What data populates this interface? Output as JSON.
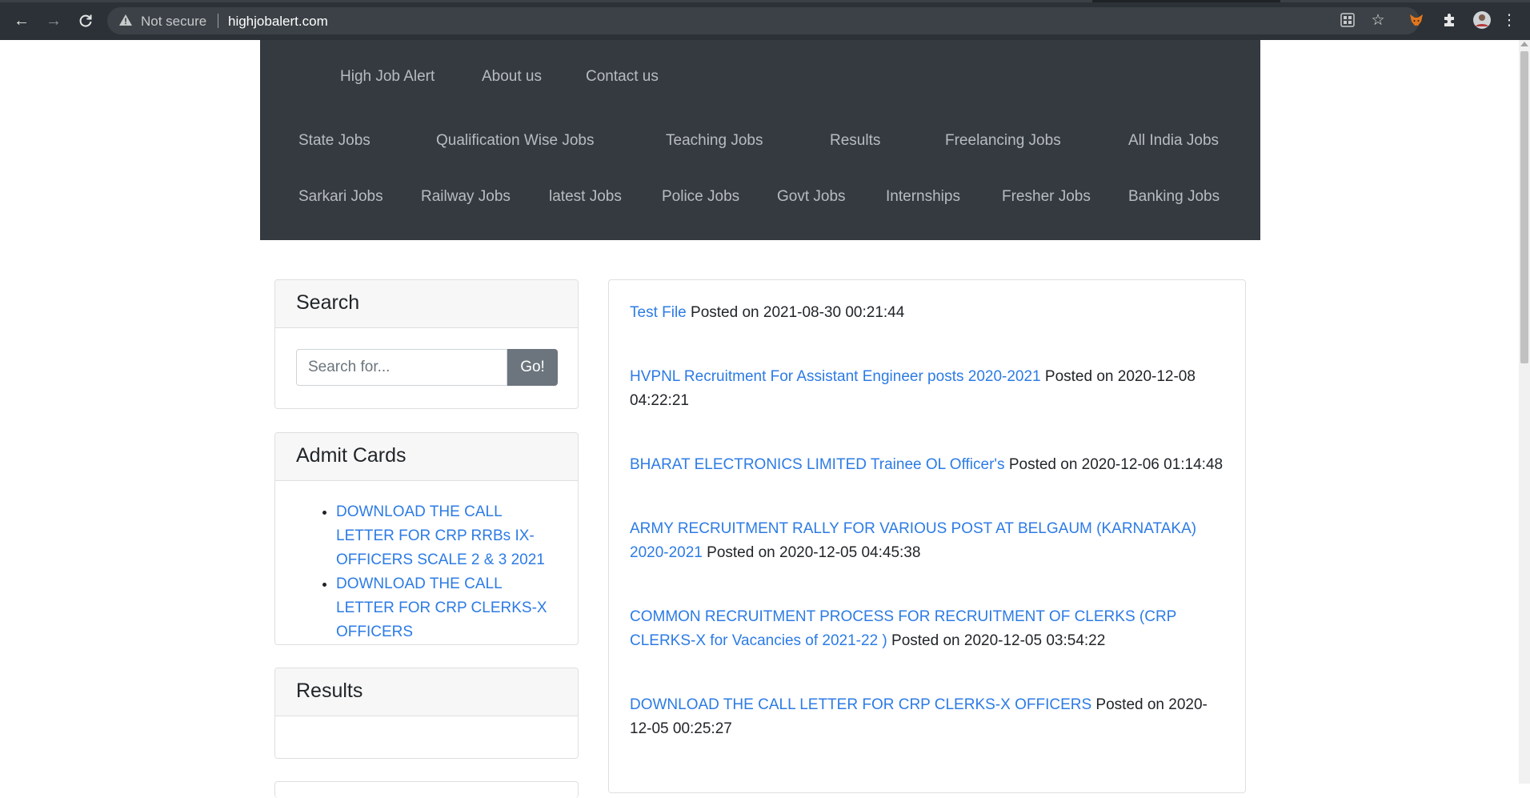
{
  "browser": {
    "security_label": "Not secure",
    "url": "highjobalert.com"
  },
  "nav": {
    "top": [
      "High Job Alert",
      "About us",
      "Contact us"
    ],
    "row1": [
      "State Jobs",
      "Qualification Wise Jobs",
      "Teaching Jobs",
      "Results",
      "Freelancing Jobs",
      "All India Jobs"
    ],
    "row2": [
      "Sarkari Jobs",
      "Railway Jobs",
      "latest Jobs",
      "Police Jobs",
      "Govt Jobs",
      "Internships",
      "Fresher Jobs",
      "Banking Jobs"
    ]
  },
  "sidebar": {
    "search": {
      "title": "Search",
      "placeholder": "Search for...",
      "button": "Go!"
    },
    "admit_cards": {
      "title": "Admit Cards",
      "items": [
        "DOWNLOAD THE CALL LETTER FOR CRP RRBs IX-OFFICERS SCALE 2 & 3 2021",
        "DOWNLOAD THE CALL LETTER FOR CRP CLERKS-X OFFICERS"
      ]
    },
    "results": {
      "title": "Results"
    }
  },
  "posts": [
    {
      "title": "Test File",
      "posted": " Posted on 2021-08-30 00:21:44"
    },
    {
      "title": "HVPNL Recruitment For Assistant Engineer posts 2020-2021",
      "posted": " Posted on 2020-12-08 04:22:21"
    },
    {
      "title": "BHARAT ELECTRONICS LIMITED Trainee OL Officer's",
      "posted": " Posted on 2020-12-06 01:14:48"
    },
    {
      "title": "ARMY RECRUITMENT RALLY FOR VARIOUS POST AT BELGAUM (KARNATAKA) 2020-2021",
      "posted": " Posted on 2020-12-05 04:45:38"
    },
    {
      "title": "COMMON RECRUITMENT PROCESS FOR RECRUITMENT OF CLERKS (CRP CLERKS-X for Vacancies of 2021-22 )",
      "posted": " Posted on 2020-12-05 03:54:22"
    },
    {
      "title": "DOWNLOAD THE CALL LETTER FOR CRP CLERKS-X OFFICERS",
      "posted": " Posted on 2020-12-05 00:25:27"
    }
  ]
}
